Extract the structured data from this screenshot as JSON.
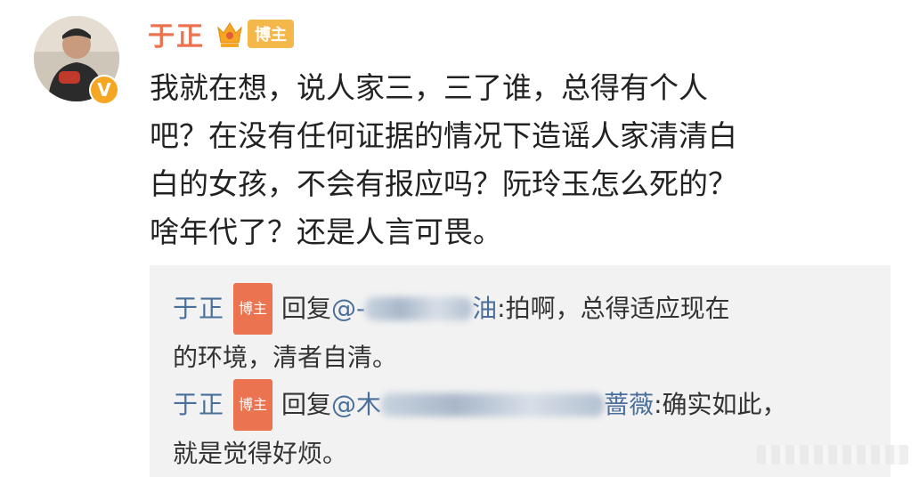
{
  "post": {
    "author": "于正",
    "author_badge": "博主",
    "verified_badge": "V",
    "lines": [
      "我就在想，说人家三，三了谁，总得有个人",
      "吧？在没有任何证据的情况下造谣人家清清白",
      "白的女孩，不会有报应吗？阮玲玉怎么死的？",
      "啥年代了？还是人言可畏。"
    ]
  },
  "replies": [
    {
      "user": "于正",
      "badge": "博主",
      "reply_prefix": "回复",
      "mention_visible_start": "@-",
      "mention_visible_end": "油",
      "text_line1": ":拍啊，总得适应现在",
      "text_line2": "的环境，清者自清。"
    },
    {
      "user": "于正",
      "badge": "博主",
      "reply_prefix": "回复",
      "mention_visible_start": "@木",
      "mention_visible_end": "蔷薇",
      "text_line1": ":确实如此，",
      "text_line2": "就是觉得好烦。"
    }
  ],
  "colors": {
    "username": "#eb7350",
    "reply_user": "#4a6f9b",
    "tag_orange": "#eb7350",
    "tag_gold": "#f4b74a",
    "reply_bg": "#f2f2f2"
  }
}
